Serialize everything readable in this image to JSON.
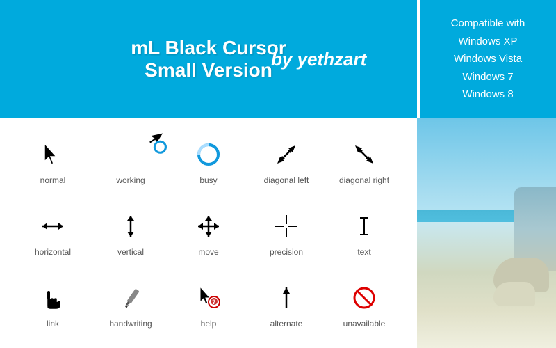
{
  "header": {
    "title_line1": "mL Black Cursor",
    "title_line2": "Small Version",
    "author": "by yethzart",
    "compatible_label": "Compatible with",
    "compatible_os": [
      "Windows XP",
      "Windows Vista",
      "Windows 7",
      "Windows 8"
    ]
  },
  "cursors": [
    {
      "id": "normal",
      "label": "normal"
    },
    {
      "id": "working",
      "label": "working"
    },
    {
      "id": "busy",
      "label": "busy"
    },
    {
      "id": "diagonal-left",
      "label": "diagonal left"
    },
    {
      "id": "diagonal-right",
      "label": "diagonal right"
    },
    {
      "id": "horizontal",
      "label": "horizontal"
    },
    {
      "id": "vertical",
      "label": "vertical"
    },
    {
      "id": "move",
      "label": "move"
    },
    {
      "id": "precision",
      "label": "precision"
    },
    {
      "id": "text",
      "label": "text"
    },
    {
      "id": "link",
      "label": "link"
    },
    {
      "id": "handwriting",
      "label": "handwriting"
    },
    {
      "id": "help",
      "label": "help"
    },
    {
      "id": "alternate",
      "label": "alternate"
    },
    {
      "id": "unavailable",
      "label": "unavailable"
    }
  ]
}
